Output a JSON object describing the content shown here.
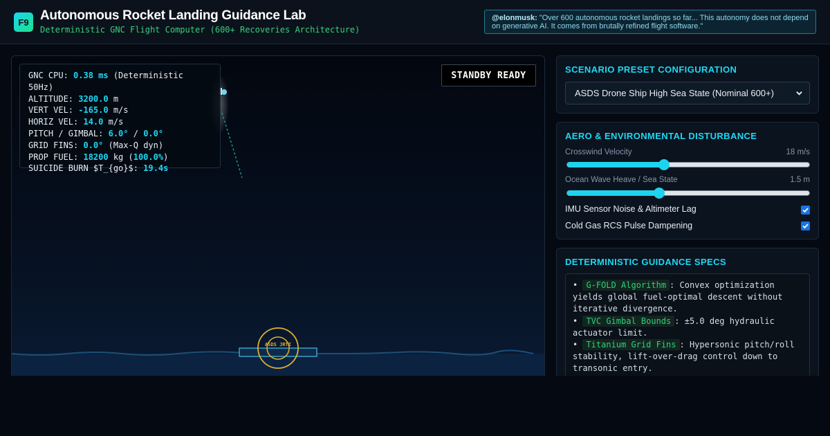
{
  "header": {
    "logo": "F9",
    "title": "Autonomous Rocket Landing Guidance Lab",
    "subtitle": "Deterministic GNC Flight Computer (600+ Recoveries Architecture)",
    "quote_author": "@elonmusk:",
    "quote_text": "\"Over 600 autonomous rocket landings so far... This autonomy does not depend on generative AI. It comes from brutally refined flight software.\""
  },
  "telemetry": {
    "cpu_label": "GNC CPU: ",
    "cpu_value": "0.38 ms",
    "cpu_suffix": " (Deterministic 50Hz)",
    "altitude_label": "ALTITUDE: ",
    "altitude_value": "3200.0",
    "altitude_unit": " m",
    "vert_label": "VERT VEL: ",
    "vert_value": "-165.0",
    "vert_unit": " m/s",
    "horiz_label": "HORIZ VEL: ",
    "horiz_value": "14.0",
    "horiz_unit": " m/s",
    "pitch_label": "PITCH / GIMBAL: ",
    "pitch_value": "6.0°",
    "pitch_sep": " / ",
    "gimbal_value": "0.0°",
    "fins_label": "GRID FINS: ",
    "fins_value": "0.0°",
    "fins_suffix": " (Max-Q dyn)",
    "fuel_label": "PROP FUEL: ",
    "fuel_value": "18200",
    "fuel_mid": " kg (",
    "fuel_pct": "100.0%",
    "fuel_end": ")",
    "burn_label": "SUICIDE BURN $T_{go}$: ",
    "burn_value": "19.4s"
  },
  "status": "STANDBY READY",
  "drone_ship_label": "ASDS JRTI",
  "colors": {
    "accent": "#1ed8f2",
    "green": "#36d07a",
    "drone_ship": "#e0b030"
  },
  "scenario": {
    "title": "SCENARIO PRESET CONFIGURATION",
    "selected": "ASDS Drone Ship High Sea State (Nominal 600+)",
    "icon": "chevron-down-icon"
  },
  "environment": {
    "title": "AERO & ENVIRONMENTAL DISTURBANCE",
    "crosswind_label": "Crosswind Velocity",
    "crosswind_value": "18 m/s",
    "crosswind_fraction": 0.4,
    "wave_label": "Ocean Wave Heave / Sea State",
    "wave_value": "1.5 m",
    "wave_fraction": 0.38,
    "imu_label": "IMU Sensor Noise & Altimeter Lag",
    "imu_checked": true,
    "rcs_label": "Cold Gas RCS Pulse Dampening",
    "rcs_checked": true
  },
  "specs": {
    "title": "DETERMINISTIC GUIDANCE SPECS",
    "items": [
      {
        "bullet": "• ",
        "tag": "G-FOLD Algorithm",
        "text": ": Convex optimization yields global fuel-optimal descent without iterative divergence."
      },
      {
        "bullet": "• ",
        "tag": "TVC Gimbal Bounds",
        "text": ": ±5.0 deg hydraulic actuator limit."
      },
      {
        "bullet": "• ",
        "tag": "Titanium Grid Fins",
        "text": ": Hypersonic pitch/roll stability, lift-over-drag control down to transonic entry."
      }
    ]
  }
}
